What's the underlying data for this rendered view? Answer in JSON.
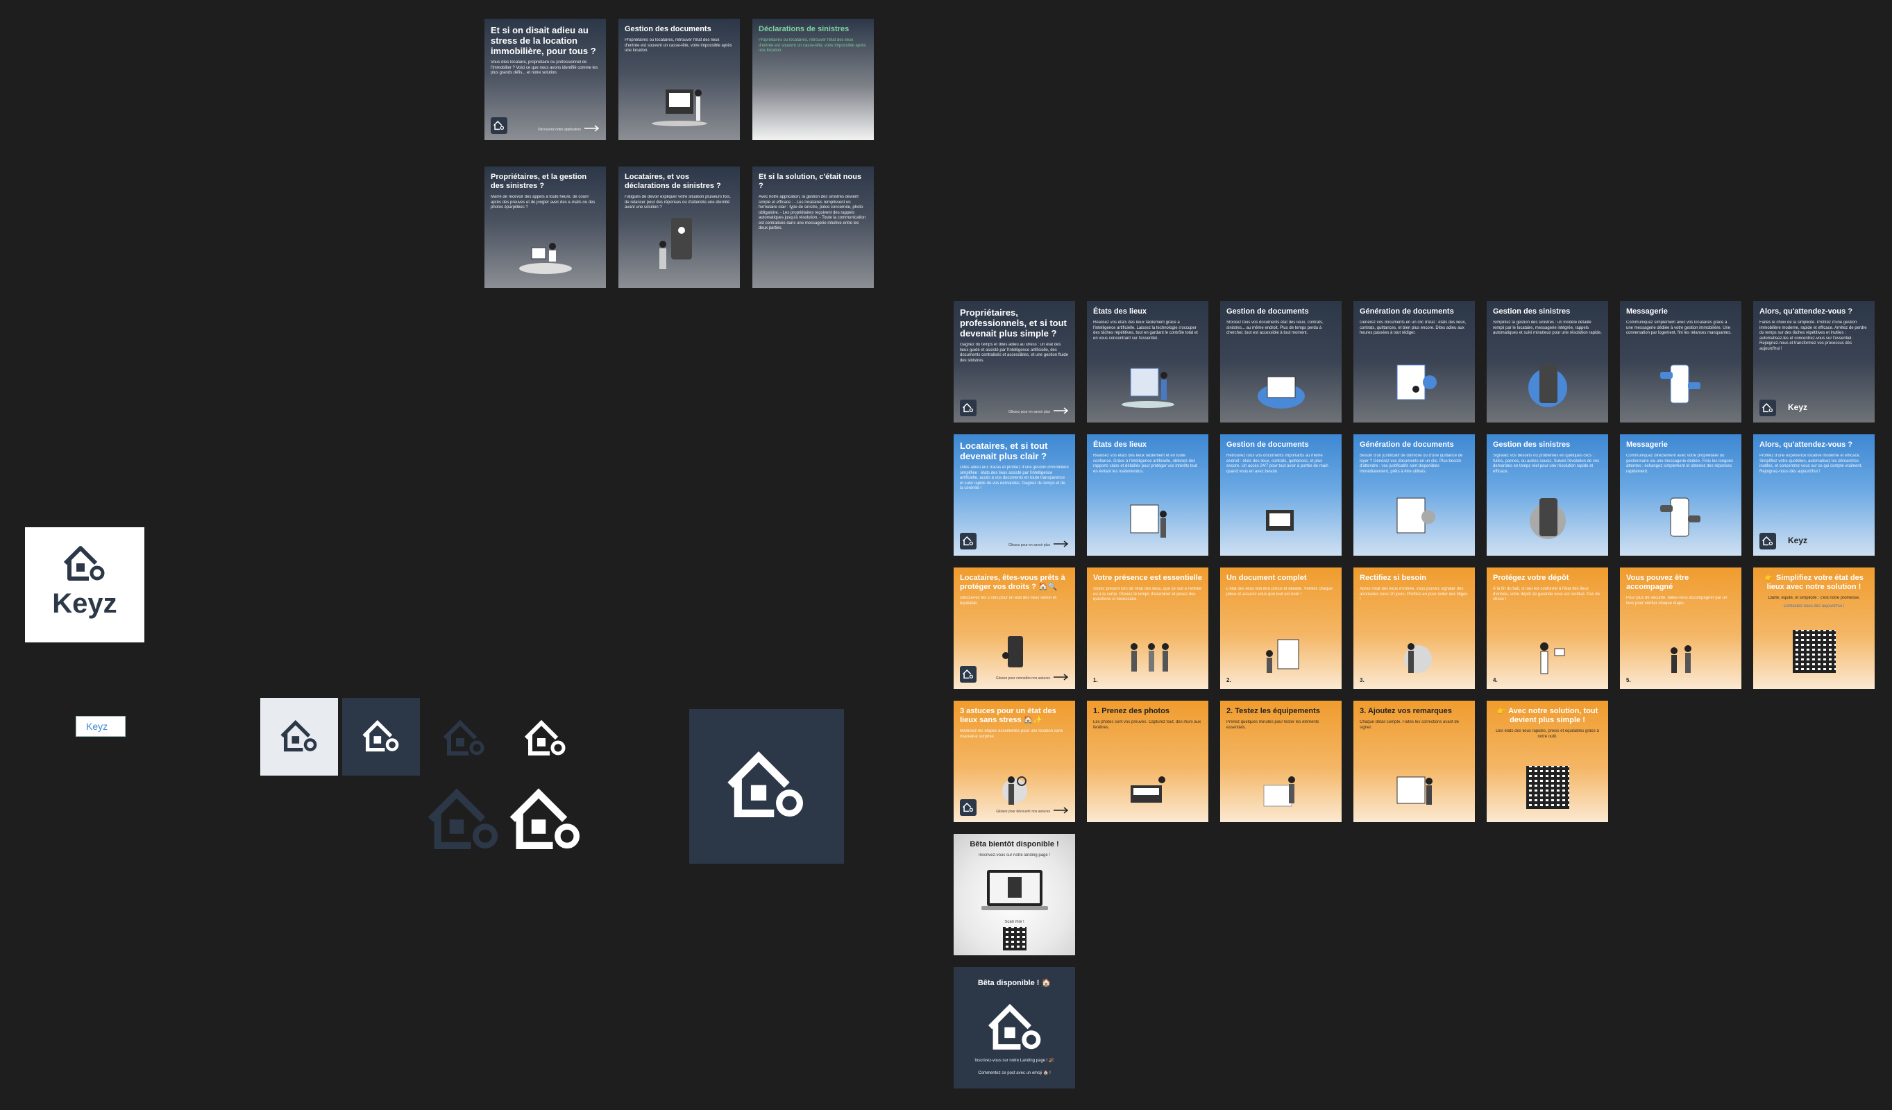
{
  "colors": {
    "canvas": "#1e1e1e",
    "navy": "#2c3748",
    "blue": "#3e88d3",
    "orange": "#f09c2e",
    "green": "#7ed3a0"
  },
  "logo": {
    "wordmark": "Keyz",
    "small_label": "Keyz"
  },
  "top_cards": [
    {
      "title": "Et si on disait adieu au stress de la location immobilière, pour tous ?",
      "text": "Vous êtes locataire, propriétaire ou professionnel de l'immobilier ? Voici ce que nous avons identifié comme les plus grands défis... et notre solution.",
      "cta": "Découvrez notre application"
    },
    {
      "title": "Gestion des documents",
      "text": "Propriétaires ou locataires, retrouver l'état des lieux d'entrée est souvent un casse-tête, voire impossible après une location."
    },
    {
      "title": "Déclarations de sinistres",
      "text": "Propriétaires ou locataires, retrouver l'état des lieux d'entrée est souvent un casse-tête, voire impossible après une location."
    },
    {
      "title": "Propriétaires, et la gestion des sinistres ?",
      "text": "Marre de recevoir des appels à toute heure, de courir après des preuves et de jongler avec des e-mails ou des photos éparpillées ?"
    },
    {
      "title": "Locataires, et vos déclarations de sinistres ?",
      "text": "Fatigués de devoir expliquer votre situation plusieurs fois, de relancer pour des réponses ou d'attendre une éternité avant une solution ?"
    },
    {
      "title": "Et si la solution, c'était nous ?",
      "text": "Avec notre application, la gestion des sinistres devient simple et efficace : - Les locataires remplissent un formulaire clair : type de sinistre, pièce concernée, photo obligatoire. - Les propriétaires reçoivent des rappels automatiques jusqu'à résolution. - Toute la communication est centralisée dans une messagerie intuitive entre les deux parties."
    }
  ],
  "row_dark": [
    {
      "title": "Propriétaires, professionnels, et si tout devenait plus simple ?",
      "text": "Gagnez du temps et dites adieu au stress : un état des lieux guidé et assisté par l'intelligence artificielle, des documents centralisés et accessibles, et une gestion fluide des sinistres.",
      "cta": "Glissez pour en savoir plus"
    },
    {
      "title": "États des lieux",
      "text": "Réalisez vos états des lieux facilement grâce à l'intelligence artificielle. Laissez la technologie s'occuper des tâches répétitives, tout en gardant le contrôle total et en vous concentrant sur l'essentiel."
    },
    {
      "title": "Gestion de documents",
      "text": "Stockez tous vos documents état des lieux, contrats, sinistres... au même endroit. Plus de temps perdu à chercher, tout est accessible à tout moment."
    },
    {
      "title": "Génération de documents",
      "text": "Générez vos documents en un clic d'état : états des lieux, contrats, quittances, et bien plus encore. Dites adieu aux heures passées à tout rédiger."
    },
    {
      "title": "Gestion des sinistres",
      "text": "Simplifiez la gestion des sinistres : un modèle détaillé rempli par le locataire, messagerie intégrée, rappels automatiques et suivi minutieux pour une résolution rapide."
    },
    {
      "title": "Messagerie",
      "text": "Communiquez simplement avec vos locataires grâce à une messagerie dédiée à votre gestion immobilière. Une conversation par logement, fini les relances manquantes."
    },
    {
      "title": "Alors, qu'attendez-vous ?",
      "text": "Faites le choix de la simplicité. Profitez d'une gestion immobilière moderne, rapide et efficace. Arrêtez de perdre du temps sur des tâches répétitives et inutiles : automatisez-les et concentrez-vous sur l'essentiel. Rejoignez-nous et transformez vos processus dès aujourd'hui !",
      "brand": "Keyz"
    }
  ],
  "row_blue": [
    {
      "title": "Locataires, et si tout devenait plus clair ?",
      "text": "Dites adieu aux tracas et profitez d'une gestion immobilière simplifiée : états des lieux assisté par l'intelligence artificielle, accès à vos documents en toute transparence et suivi rapide de vos demandes. Gagnez du temps et de la sérénité !",
      "cta": "Glissez pour en savoir plus"
    },
    {
      "title": "États des lieux",
      "text": "Réalisez vos états des lieux facilement et en toute confiance. Grâce à l'intelligence artificielle, obtenez des rapports clairs et détaillés pour protéger vos intérêts tout en évitant les malentendus."
    },
    {
      "title": "Gestion de documents",
      "text": "Retrouvez tous vos documents importants au même endroit : états des lieux, contrats, quittances, et plus encore. Un accès 24/7 pour tout avoir à portée de main quand vous en avez besoin."
    },
    {
      "title": "Génération de documents",
      "text": "Besoin d'un justificatif de domicile ou d'une quittance de loyer ? Générez vos documents en un clic. Plus besoin d'attendre : vos justificatifs sont disponibles immédiatement, prêts à être utilisés."
    },
    {
      "title": "Gestion des sinistres",
      "text": "Signalez vos besoins ou problèmes en quelques clics : fuites, pannes, ou autres soucis. Suivez l'évolution de vos demandes en temps réel pour une résolution rapide et efficace."
    },
    {
      "title": "Messagerie",
      "text": "Communiquez directement avec votre propriétaire ou gestionnaire via une messagerie dédiée. Finis les longues attentes : échangez simplement et obtenez des réponses rapidement."
    },
    {
      "title": "Alors, qu'attendez-vous ?",
      "text": "Profitez d'une expérience locative moderne et efficace. Simplifiez votre quotidien, automatisez les démarches inutiles, et concentrez-vous sur ce qui compte vraiment. Rejoignez-nous dès aujourd'hui !",
      "brand": "Keyz"
    }
  ],
  "row_orange": [
    {
      "title": "Locataires, êtes-vous prêts à protéger vos droits ? 🏠🔍",
      "text": "Découvrez les 5 clés pour un état des lieux serein et équitable.",
      "cta": "Glissez pour connaître nos astuces"
    },
    {
      "title": "Votre présence est essentielle",
      "text": "Soyez présent lors de l'état des lieux, que ce soit à l'entrée ou à la sortie. Prenez le temps d'examiner et posez des questions si nécessaire.",
      "num": "1."
    },
    {
      "title": "Un document complet",
      "text": "L'état des lieux doit être précis et détaillé. Vérifiez chaque pièce et assurez-vous que tout est noté !",
      "num": "2."
    },
    {
      "title": "Rectifiez si besoin",
      "text": "Après l'état des lieux d'entrée, vous pouvez signaler des anomalies sous 10 jours. Profitez-en pour éviter des litiges !",
      "num": "3."
    },
    {
      "title": "Protégez votre dépôt",
      "text": "À la fin du bail, si tout est conforme à l'état des lieux d'entrée, votre dépôt de garantie vous est restitué. Pas de stress !",
      "num": "4."
    },
    {
      "title": "Vous pouvez être accompagné",
      "text": "Pour plus de sécurité, faites-vous accompagner par un tiers pour vérifier chaque étape.",
      "num": "5."
    },
    {
      "title": "👉 Simplifiez votre état des lieux avec notre solution !",
      "text": "Clarté, équité, et simplicité : c'est notre promesse.",
      "cta": "Contactez-nous dès aujourd'hui !"
    }
  ],
  "row_orange2": [
    {
      "title": "3 astuces pour un état des lieux sans stress 🏠✨",
      "text": "Maîtrisez les étapes essentielles pour une location sans mauvaise surprise.",
      "cta": "Glissez pour découvrir nos astuces"
    },
    {
      "title": "1. Prenez des photos",
      "text": "Les photos sont vos preuves. Capturez tout, des murs aux fenêtres."
    },
    {
      "title": "2. Testez les équipements",
      "text": "Prenez quelques minutes pour tester les éléments essentiels."
    },
    {
      "title": "3. Ajoutez vos remarques",
      "text": "Chaque détail compte. Faites les corrections avant de signer."
    },
    {
      "title": "👉 Avec notre solution, tout devient plus simple !",
      "text": "Des états des lieux rapides, précis et équitables grâce à notre outil."
    }
  ],
  "beta_soon": {
    "title": "Bêta bientôt disponible !",
    "text": "Inscrivez-vous sur notre landing page !",
    "sub": "Scan moi !"
  },
  "beta_now": {
    "title": "Bêta disponible ! 🏠",
    "text": "Inscrivez-vous sur notre Landing page ! 🎉",
    "sub": "Commentez ce post avec un emoji 🏠 !"
  }
}
